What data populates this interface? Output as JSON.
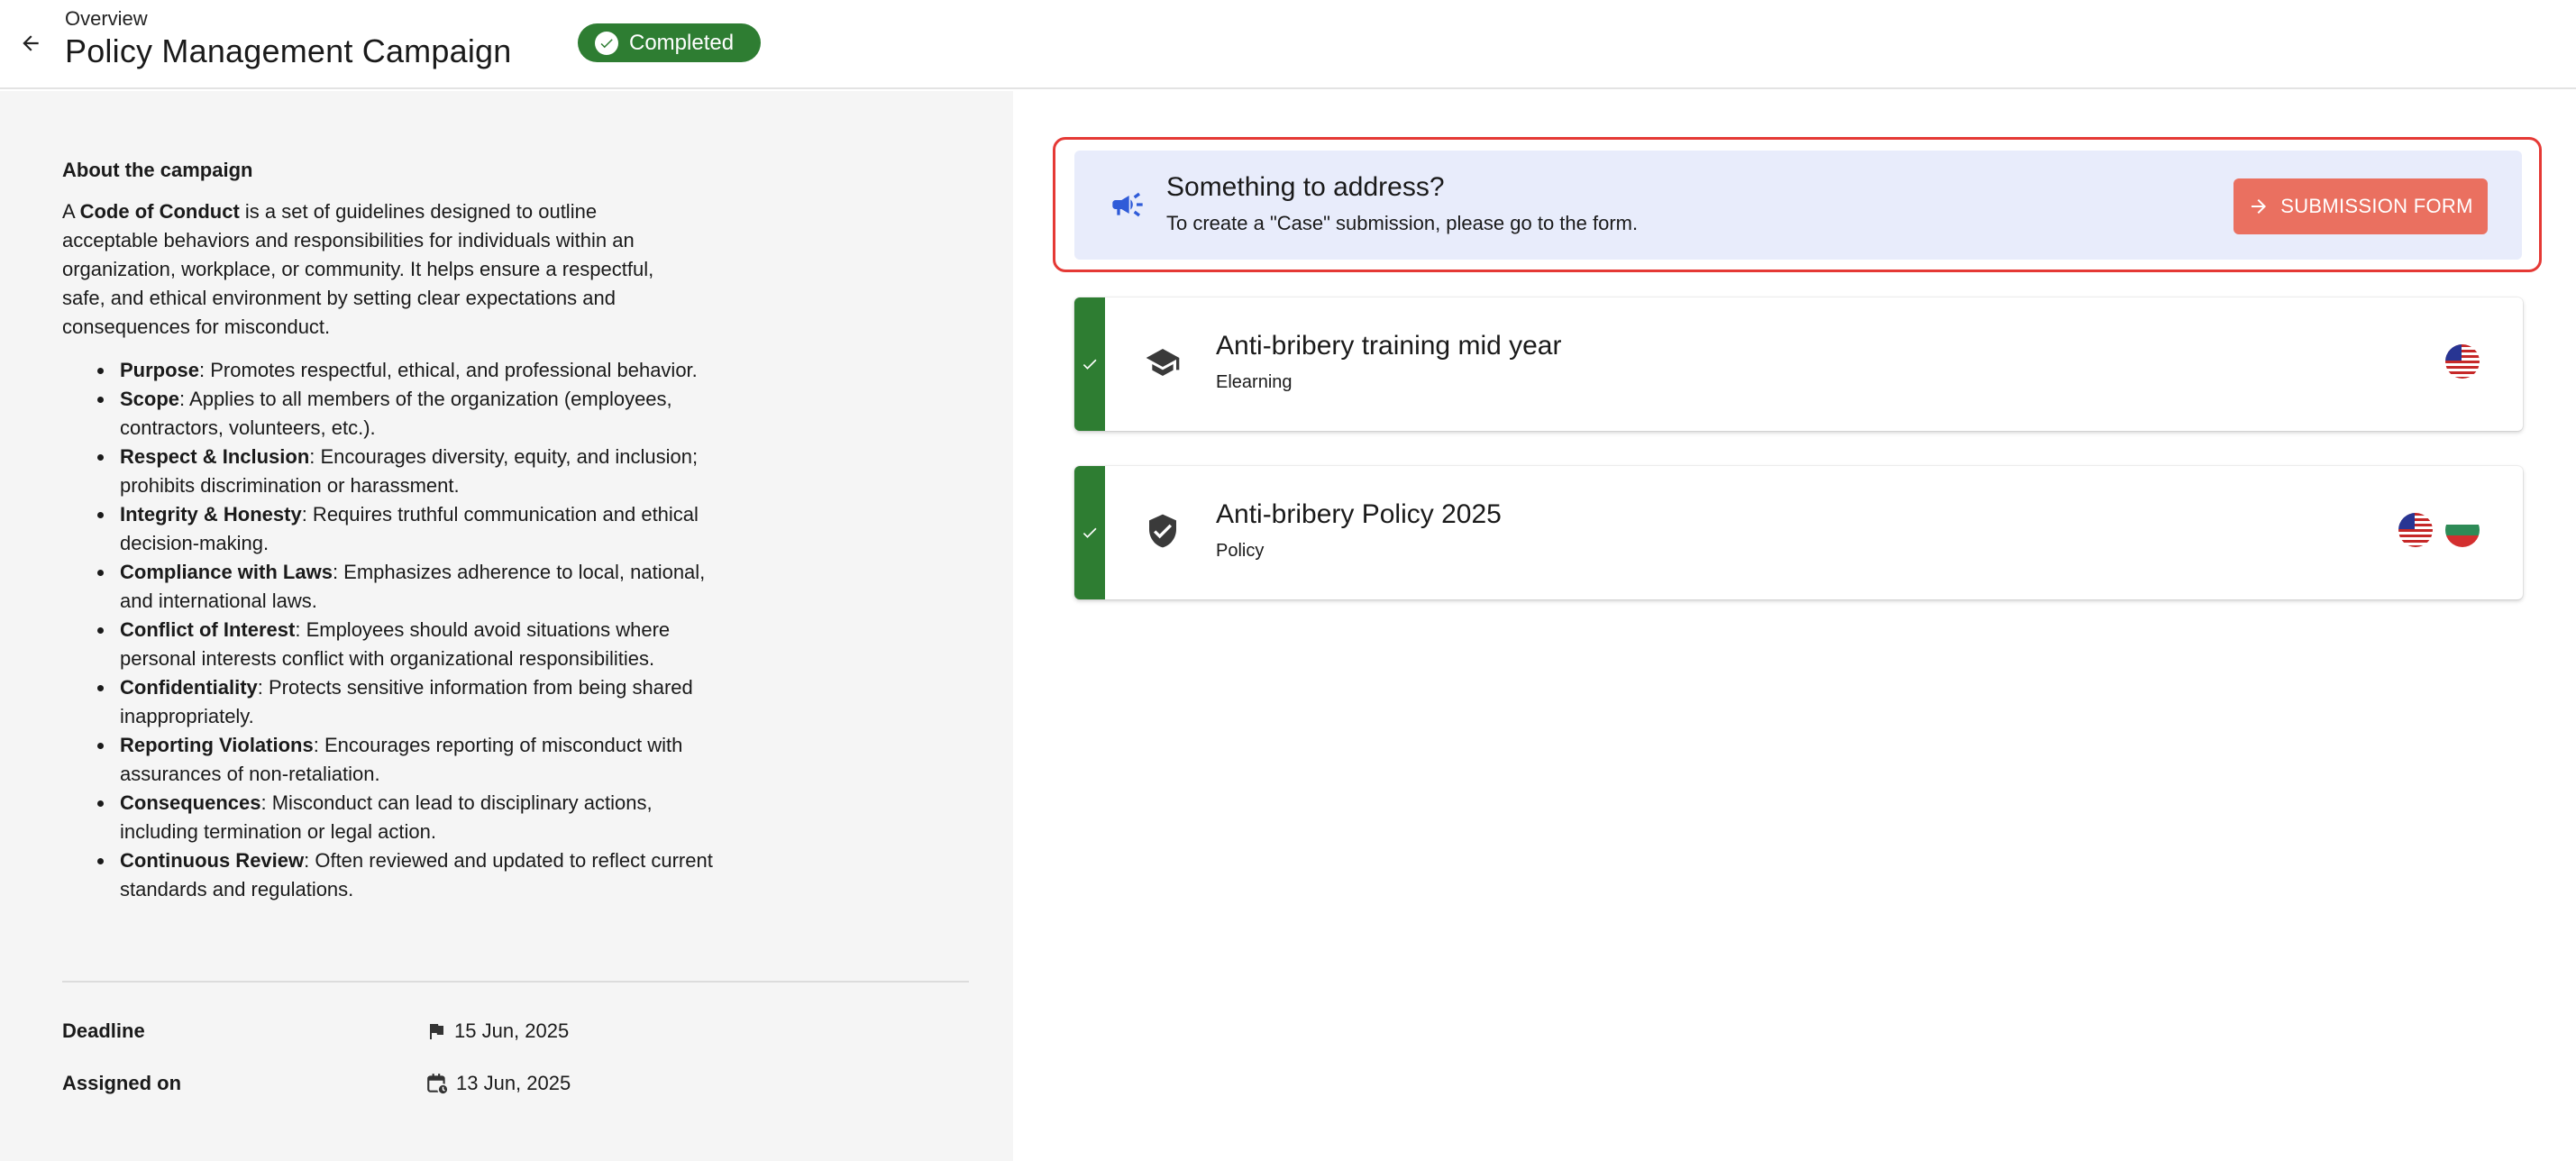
{
  "header": {
    "breadcrumb": "Overview",
    "title": "Policy Management Campaign",
    "status": "Completed",
    "status_color": "#2e7d32"
  },
  "about": {
    "heading": "About the campaign",
    "intro_prefix": "A ",
    "intro_bold": "Code of Conduct",
    "intro_rest": " is a set of guidelines designed to outline acceptable behaviors and responsibilities for individuals within an organization, workplace, or community. It helps ensure a respectful, safe, and ethical environment by setting clear expectations and consequences for misconduct.",
    "bullets": [
      {
        "term": "Purpose",
        "text": ": Promotes respectful, ethical, and professional behavior."
      },
      {
        "term": "Scope",
        "text": ": Applies to all members of the organization (employees, contractors, volunteers, etc.)."
      },
      {
        "term": "Respect & Inclusion",
        "text": ": Encourages diversity, equity, and inclusion; prohibits discrimination or harassment."
      },
      {
        "term": "Integrity & Honesty",
        "text": ": Requires truthful communication and ethical decision-making."
      },
      {
        "term": "Compliance with Laws",
        "text": ": Emphasizes adherence to local, national, and international laws."
      },
      {
        "term": "Conflict of Interest",
        "text": ": Employees should avoid situations where personal interests conflict with organizational responsibilities."
      },
      {
        "term": "Confidentiality",
        "text": ": Protects sensitive information from being shared inappropriately."
      },
      {
        "term": "Reporting Violations",
        "text": ": Encourages reporting of misconduct with assurances of non-retaliation."
      },
      {
        "term": "Consequences",
        "text": ": Misconduct can lead to disciplinary actions, including termination or legal action."
      },
      {
        "term": "Continuous Review",
        "text": ": Often reviewed and updated to reflect current standards and regulations."
      }
    ]
  },
  "meta": {
    "deadline_label": "Deadline",
    "deadline_value": "15 Jun, 2025",
    "assigned_label": "Assigned on",
    "assigned_value": "13 Jun, 2025"
  },
  "callout": {
    "title": "Something to address?",
    "subtitle": "To create a \"Case\" submission, please go to the form.",
    "button": "SUBMISSION FORM",
    "icon": "megaphone-icon",
    "accent": "#ea7060"
  },
  "items": [
    {
      "title": "Anti-bribery training mid year",
      "type": "Elearning",
      "icon": "graduation-cap-icon",
      "languages": [
        "us-flag"
      ],
      "completed": true
    },
    {
      "title": "Anti-bribery Policy 2025",
      "type": "Policy",
      "icon": "shield-check-icon",
      "languages": [
        "us-flag",
        "bulgaria-flag"
      ],
      "completed": true
    }
  ]
}
